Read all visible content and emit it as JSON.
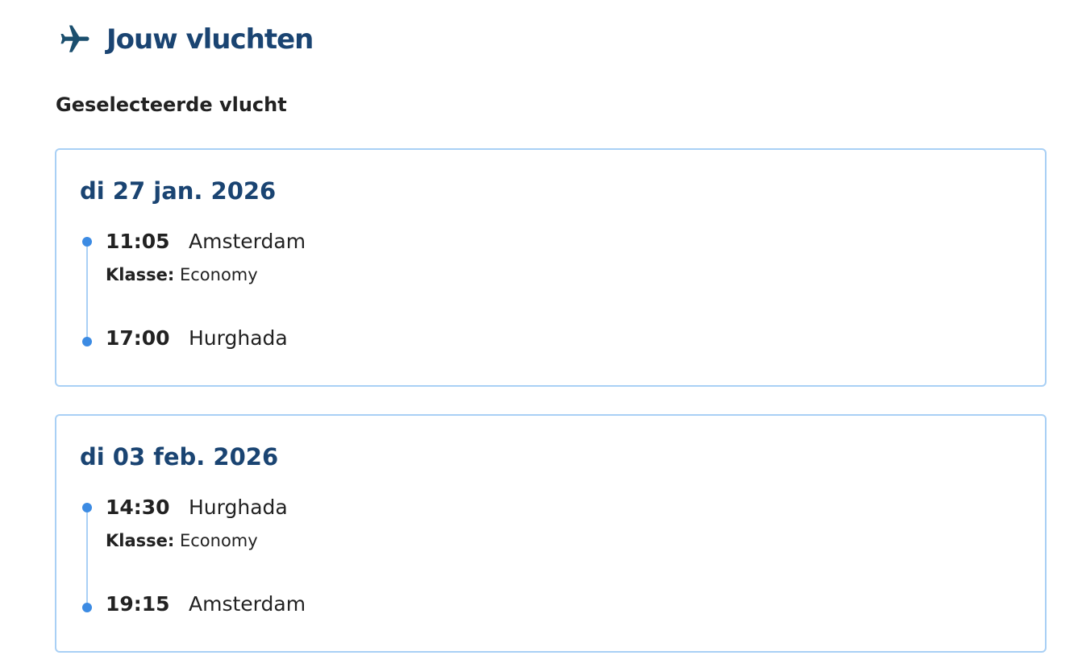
{
  "header": {
    "icon": "plane-icon",
    "title": "Jouw vluchten"
  },
  "section": {
    "title": "Geselecteerde vlucht"
  },
  "flights": [
    {
      "date": "di 27 jan. 2026",
      "departure": {
        "time": "11:05",
        "city": "Amsterdam"
      },
      "class_label": "Klasse:",
      "class_value": "Economy",
      "arrival": {
        "time": "17:00",
        "city": "Hurghada"
      }
    },
    {
      "date": "di 03 feb. 2026",
      "departure": {
        "time": "14:30",
        "city": "Hurghada"
      },
      "class_label": "Klasse:",
      "class_value": "Economy",
      "arrival": {
        "time": "19:15",
        "city": "Amsterdam"
      }
    }
  ],
  "colors": {
    "title_blue": "#1a4472",
    "card_border": "#a9d0f5",
    "timeline_dot": "#3c8be3",
    "icon_teal": "#1b4f6e"
  }
}
